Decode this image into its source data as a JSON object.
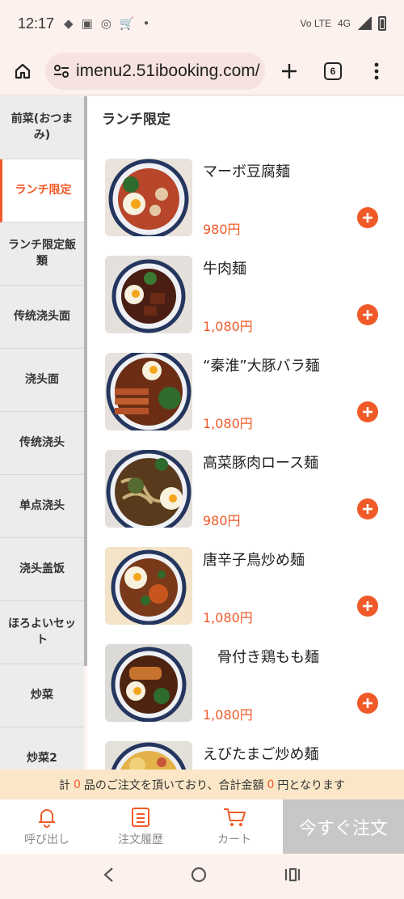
{
  "status": {
    "time": "12:17",
    "network": "4G",
    "volte": "Vo LTE"
  },
  "browser": {
    "url": "imenu2.51ibooking.com/",
    "tab_count": "6"
  },
  "sidebar": {
    "items": [
      {
        "label": "前菜(おつまみ)"
      },
      {
        "label": "ランチ限定"
      },
      {
        "label": "ランチ限定飯類"
      },
      {
        "label": "传统浇头面"
      },
      {
        "label": "浇头面"
      },
      {
        "label": "传统浇头"
      },
      {
        "label": "单点浇头"
      },
      {
        "label": "浇头盖饭"
      },
      {
        "label": "ほろよいセット"
      },
      {
        "label": "炒菜"
      },
      {
        "label": "炒菜2"
      }
    ]
  },
  "section": {
    "title": "ランチ限定"
  },
  "menu": {
    "items": [
      {
        "name": "マーボ豆腐麺",
        "price": "980円"
      },
      {
        "name": "牛肉麺",
        "price": "1,080円"
      },
      {
        "name": "“秦淮”大豚バラ麺",
        "price": "1,080円"
      },
      {
        "name": "高菜豚肉ロース麺",
        "price": "980円"
      },
      {
        "name": "唐辛子鳥炒め麺",
        "price": "1,080円"
      },
      {
        "name": "　骨付き鶏もも麺",
        "price": "1,080円"
      },
      {
        "name": "えびたまご炒め麺",
        "price": ""
      }
    ]
  },
  "summary": {
    "prefix": "計",
    "count": "0",
    "middle": "品のご注文を頂いており、合計金額",
    "amount": "0",
    "suffix": "円となります"
  },
  "bottom": {
    "call_label": "呼び出し",
    "history_label": "注文履歴",
    "cart_label": "カート",
    "order_label": "今すぐ注文"
  },
  "colors": {
    "accent": "#f05a28",
    "summary_bg": "#fbe7c7",
    "order_disabled": "#c7c7c7"
  }
}
